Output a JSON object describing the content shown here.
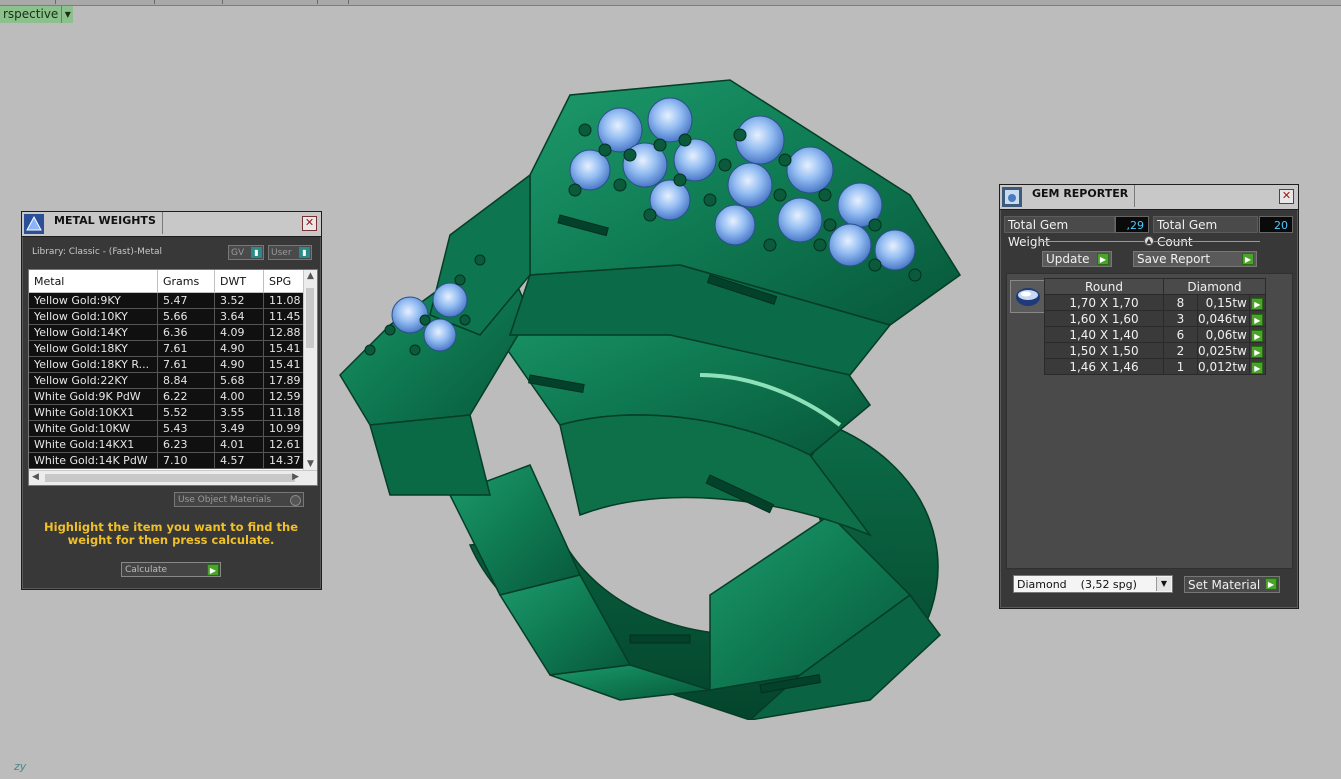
{
  "viewport": {
    "view_label": "rspective",
    "axis_label": "zy"
  },
  "metal_weights": {
    "title": "METAL WEIGHTS",
    "library_label": "Library: Classic - (Fast)-Metal",
    "gv_label": "GV",
    "user_label": "User",
    "columns": [
      "Metal",
      "Grams",
      "DWT",
      "SPG"
    ],
    "rows": [
      [
        "Yellow Gold:9KY",
        "5.47",
        "3.52",
        "11.08"
      ],
      [
        "Yellow Gold:10KY",
        "5.66",
        "3.64",
        "11.45"
      ],
      [
        "Yellow Gold:14KY",
        "6.36",
        "4.09",
        "12.88"
      ],
      [
        "Yellow Gold:18KY",
        "7.61",
        "4.90",
        "15.41"
      ],
      [
        "Yellow Gold:18KY R...",
        "7.61",
        "4.90",
        "15.41"
      ],
      [
        "Yellow Gold:22KY",
        "8.84",
        "5.68",
        "17.89"
      ],
      [
        "White Gold:9K PdW",
        "6.22",
        "4.00",
        "12.59"
      ],
      [
        "White Gold:10KX1",
        "5.52",
        "3.55",
        "11.18"
      ],
      [
        "White Gold:10KW",
        "5.43",
        "3.49",
        "10.99"
      ],
      [
        "White Gold:14KX1",
        "6.23",
        "4.01",
        "12.61"
      ],
      [
        "White Gold:14K PdW",
        "7.10",
        "4.57",
        "14.37"
      ]
    ],
    "use_object_materials": "Use Object Materials",
    "hint": "Highlight the item you want to find the weight for then press calculate.",
    "calculate_label": "Calculate"
  },
  "gem_reporter": {
    "title": "GEM REPORTER",
    "total_weight_label": "Total Gem Weight",
    "total_weight_value": ",29",
    "total_count_label": "Total Gem Count",
    "total_count_value": "20",
    "update_label": "Update",
    "save_label": "Save Report",
    "columns": [
      "Round",
      "Diamond"
    ],
    "gems": [
      {
        "size": "1,70 X 1,70",
        "count": "8",
        "weight": "0,15tw"
      },
      {
        "size": "1,60 X 1,60",
        "count": "3",
        "weight": "0,046tw"
      },
      {
        "size": "1,40 X 1,40",
        "count": "6",
        "weight": "0,06tw"
      },
      {
        "size": "1,50 X 1,50",
        "count": "2",
        "weight": "0,025tw"
      },
      {
        "size": "1,46 X 1,46",
        "count": "1",
        "weight": "0,012tw"
      }
    ],
    "material_select": "Diamond    (3,52 spg)",
    "set_material_label": "Set Material"
  },
  "colors": {
    "model_green": "#137a55",
    "gem_blue": "#8cb8ef",
    "panel_bg": "#383838",
    "highlight": "#f0c028"
  }
}
